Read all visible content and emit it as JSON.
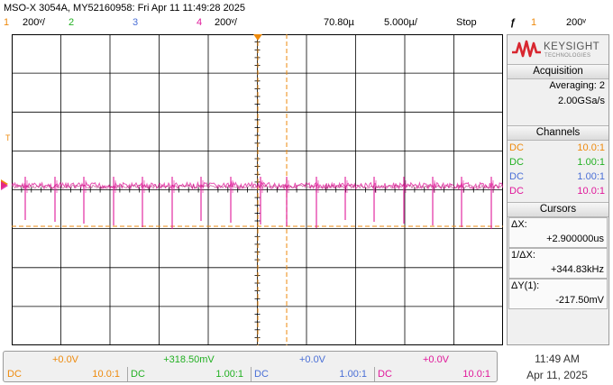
{
  "header": {
    "title": "MSO-X 3054A, MY52160958: Fri Apr 11 11:49:28 2025",
    "ch1_num": "1",
    "ch1_scale": "200ᵛ/",
    "ch2_num": "2",
    "ch3_num": "3",
    "ch4_num": "4",
    "ch4_scale": "200ᵛ/",
    "time_delay": "70.80µ",
    "time_scale": "5.000µ/",
    "run_state": "Stop",
    "trig_symbol": "ƒ",
    "trig_source": "1",
    "trig_level": "200ᵛ"
  },
  "markers": {
    "trigger_level": "T"
  },
  "brand": {
    "name": "KEYSIGHT",
    "sub": "TECHNOLOGIES"
  },
  "acquisition": {
    "title": "Acquisition",
    "mode": "Averaging: 2",
    "rate": "2.00GSa/s"
  },
  "channels": {
    "title": "Channels",
    "rows": [
      {
        "coupling": "DC",
        "probe": "10.0:1",
        "color": "#ee8a0c"
      },
      {
        "coupling": "DC",
        "probe": "1.00:1",
        "color": "#22b022"
      },
      {
        "coupling": "DC",
        "probe": "1.00:1",
        "color": "#4a6fd6"
      },
      {
        "coupling": "DC",
        "probe": "10.0:1",
        "color": "#e0189a"
      }
    ]
  },
  "cursors": {
    "title": "Cursors",
    "dx_label": "ΔX:",
    "dx_value": "+2.900000us",
    "inv_label": "1/ΔX:",
    "inv_value": "+344.83kHz",
    "dy_label": "ΔY(1):",
    "dy_value": "-217.50mV"
  },
  "bottom": {
    "ch1": {
      "offset": "+0.0V",
      "coupling": "DC",
      "probe": "10.0:1"
    },
    "ch2": {
      "offset": "+318.50mV",
      "coupling": "DC",
      "probe": "1.00:1"
    },
    "ch3": {
      "offset": "+0.0V",
      "coupling": "DC",
      "probe": "1.00:1"
    },
    "ch4": {
      "offset": "+0.0V",
      "coupling": "DC",
      "probe": "10.0:1"
    }
  },
  "clock": {
    "time": "11:49 AM",
    "date": "Apr 11, 2025"
  },
  "colors": {
    "ch1": "#ee8a0c",
    "ch2": "#22b022",
    "ch3": "#4a6fd6",
    "ch4": "#e0189a",
    "grid": "#000000",
    "cursor": "#ee8a0c"
  }
}
